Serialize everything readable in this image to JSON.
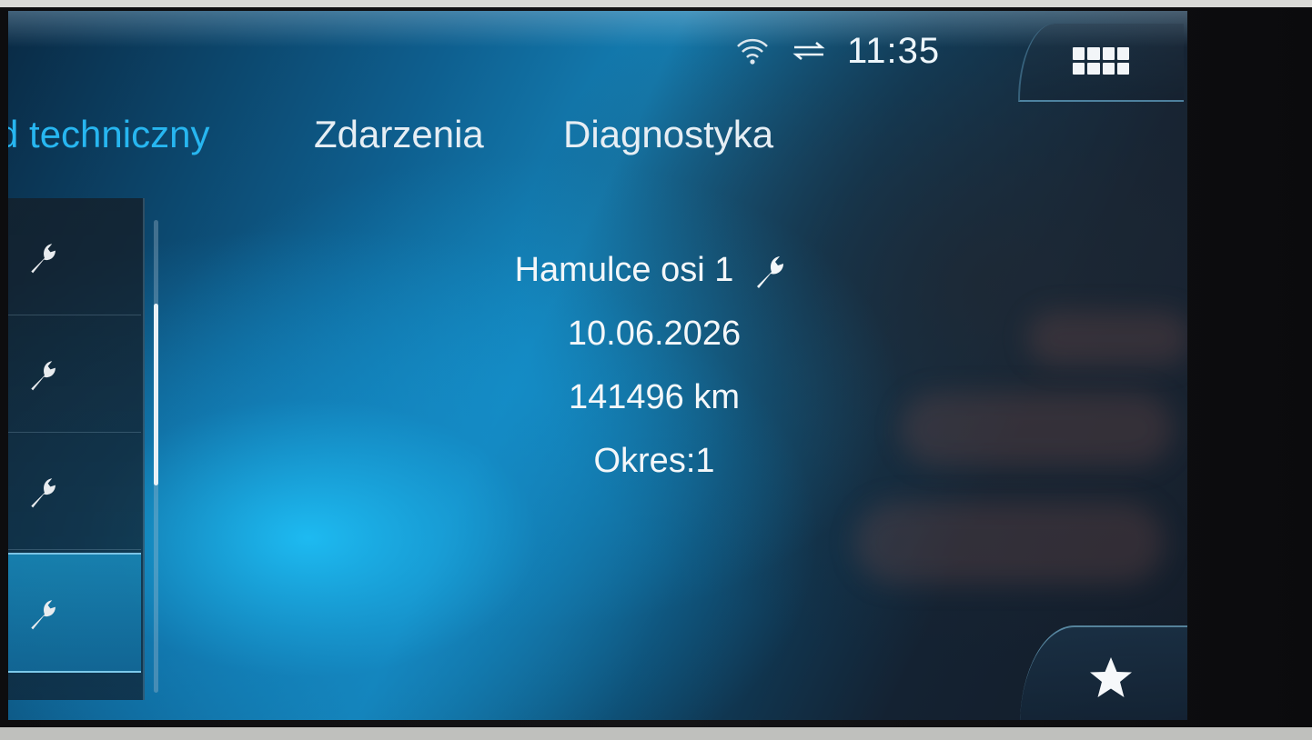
{
  "status_bar": {
    "wifi_icon": "wifi-icon",
    "connection_icon": "data-transfer-icon",
    "time": "11:35",
    "menu_icon": "grid-menu-icon"
  },
  "tabs": [
    {
      "label": "d techniczny",
      "active": true
    },
    {
      "label": "Zdarzenia",
      "active": false
    },
    {
      "label": "Diagnostyka",
      "active": false
    }
  ],
  "service_list": {
    "item_icon": "wrench-icon",
    "item_count": 4,
    "selected_index": 3
  },
  "detail": {
    "title": "Hamulce osi 1",
    "title_icon": "wrench-icon",
    "date": "10.06.2026",
    "mileage": "141496 km",
    "period": "Okres:1"
  },
  "favorite_icon": "star-icon",
  "colors": {
    "accent": "#27b6f0",
    "text": "#f4f7f9"
  }
}
